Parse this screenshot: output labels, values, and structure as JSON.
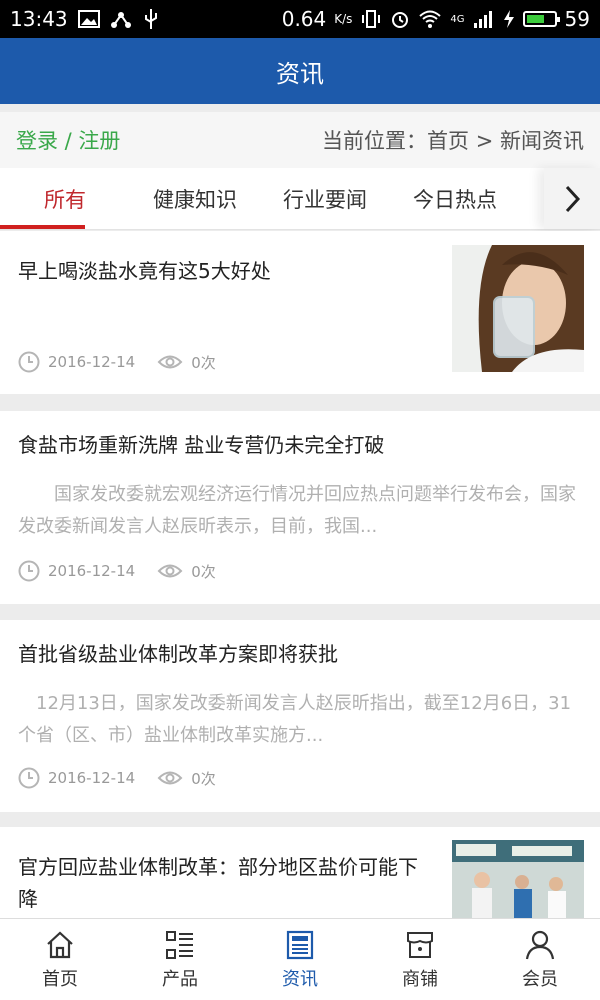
{
  "status_bar": {
    "time": "13:43",
    "speed": "0.64",
    "speed_unit": "K/s",
    "network": "4G",
    "battery": "59"
  },
  "app_bar": {
    "title": "资讯"
  },
  "location_bar": {
    "login_label": "登录 / 注册",
    "breadcrumb": "当前位置：首页 > 新闻资讯"
  },
  "tabs": [
    {
      "label": "所有"
    },
    {
      "label": "健康知识"
    },
    {
      "label": "行业要闻"
    },
    {
      "label": "今日热点"
    }
  ],
  "articles": [
    {
      "title": "早上喝淡盐水竟有这5大好处",
      "date": "2016-12-14",
      "views": "0次"
    },
    {
      "title": "食盐市场重新洗牌 盐业专营仍未完全打破",
      "summary": "　　国家发改委就宏观经济运行情况并回应热点问题举行发布会，国家发改委新闻发言人赵辰昕表示，目前，我国...",
      "date": "2016-12-14",
      "views": "0次"
    },
    {
      "title": "首批省级盐业体制改革方案即将获批",
      "summary": "　12月13日，国家发改委新闻发言人赵辰昕指出，截至12月6日，31个省（区、市）盐业体制改革实施方...",
      "date": "2016-12-14",
      "views": "0次"
    },
    {
      "title": "官方回应盐业体制改革：部分地区盐价可能下降"
    }
  ],
  "bottom_nav": [
    {
      "label": "首页",
      "icon": "home-icon"
    },
    {
      "label": "产品",
      "icon": "list-icon"
    },
    {
      "label": "资讯",
      "icon": "news-icon"
    },
    {
      "label": "商铺",
      "icon": "shop-icon"
    },
    {
      "label": "会员",
      "icon": "user-icon"
    }
  ],
  "colors": {
    "app_bar": "#1d5aab",
    "active_tab": "#c0282d",
    "login": "#3aa84a",
    "active_nav": "#1d5aab"
  }
}
